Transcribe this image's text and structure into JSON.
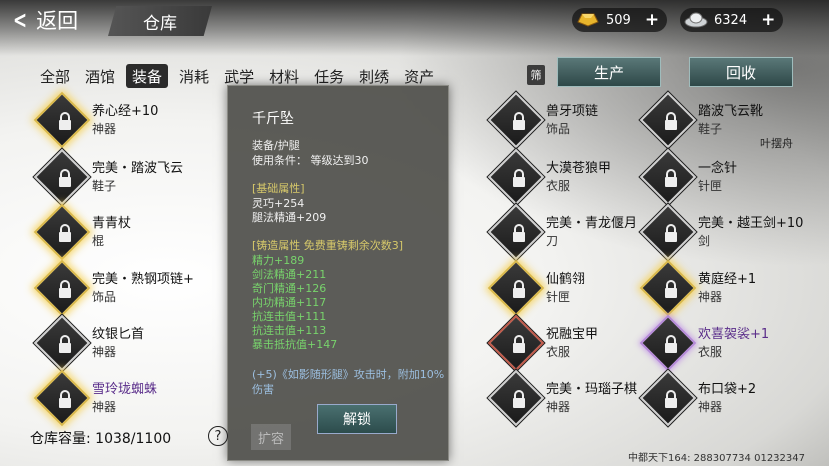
{
  "header": {
    "back_label": "返回",
    "title": "仓库",
    "gold": "509",
    "silver": "6324",
    "plus": "+"
  },
  "tabs": [
    "全部",
    "酒馆",
    "装备",
    "消耗",
    "武学",
    "材料",
    "任务",
    "刺绣",
    "资产"
  ],
  "active_tab": "装备",
  "filter_label": "筛",
  "buttons": {
    "produce": "生产",
    "recycle": "回收",
    "unlock": "解锁",
    "expand": "扩容"
  },
  "items": [
    {
      "name": "养心经+10",
      "cat": "神器",
      "frame": "gold"
    },
    {
      "name": "完美・踏波飞云",
      "cat": "鞋子",
      "frame": "silver"
    },
    {
      "name": "青青杖",
      "cat": "棍",
      "frame": "gold"
    },
    {
      "name": "完美・熟钢项链+",
      "cat": "饰品",
      "frame": "gold"
    },
    {
      "name": "纹银匕首",
      "cat": "神器",
      "frame": "silver"
    },
    {
      "name": "雪玲珑蜘蛛",
      "cat": "神器",
      "frame": "gold",
      "purple": true
    },
    {
      "name": "兽牙项链",
      "cat": "饰品",
      "frame": "silver"
    },
    {
      "name": "大漠苍狼甲",
      "cat": "衣服",
      "frame": "silver"
    },
    {
      "name": "完美・青龙偃月",
      "cat": "刀",
      "frame": "silver"
    },
    {
      "name": "仙鹤翎",
      "cat": "针匣",
      "frame": "gold"
    },
    {
      "name": "祝融宝甲",
      "cat": "衣服",
      "frame": "red"
    },
    {
      "name": "完美・玛瑙子棋",
      "cat": "神器",
      "frame": "silver"
    },
    {
      "name": "踏波飞云靴",
      "cat": "鞋子",
      "frame": "silver"
    },
    {
      "name": "一念针",
      "cat": "针匣",
      "frame": "silver"
    },
    {
      "name": "完美・越王剑+10",
      "cat": "剑",
      "frame": "silver"
    },
    {
      "name": "黄庭经+1",
      "cat": "神器",
      "frame": "gold"
    },
    {
      "name": "欢喜袈裟+1",
      "cat": "衣服",
      "frame": "purple",
      "purple": true
    },
    {
      "name": "布口袋+2",
      "cat": "神器",
      "frame": "silver"
    }
  ],
  "side_note": "叶摆舟",
  "detail": {
    "name": "千斤坠",
    "type": "装备/护腿",
    "requirement": "使用条件：  等级达到30",
    "base_title": "[基础属性]",
    "base_stats": [
      "灵巧+254",
      "腿法精通+209"
    ],
    "forge_title": "[铸造属性  免费重铸剩余次数3]",
    "forge_stats": [
      "精力+189",
      "剑法精通+211",
      "奇门精通+126",
      "内功精通+117",
      "抗连击值+111",
      "抗连击值+113",
      "暴击抵抗值+147"
    ],
    "note1": "(+5)《如影随形腿》攻击时，附加10%",
    "note2": "伤害"
  },
  "capacity": "仓库容量: 1038/1100",
  "help": "?",
  "footer": "中都天下164: 288307734  01232347"
}
